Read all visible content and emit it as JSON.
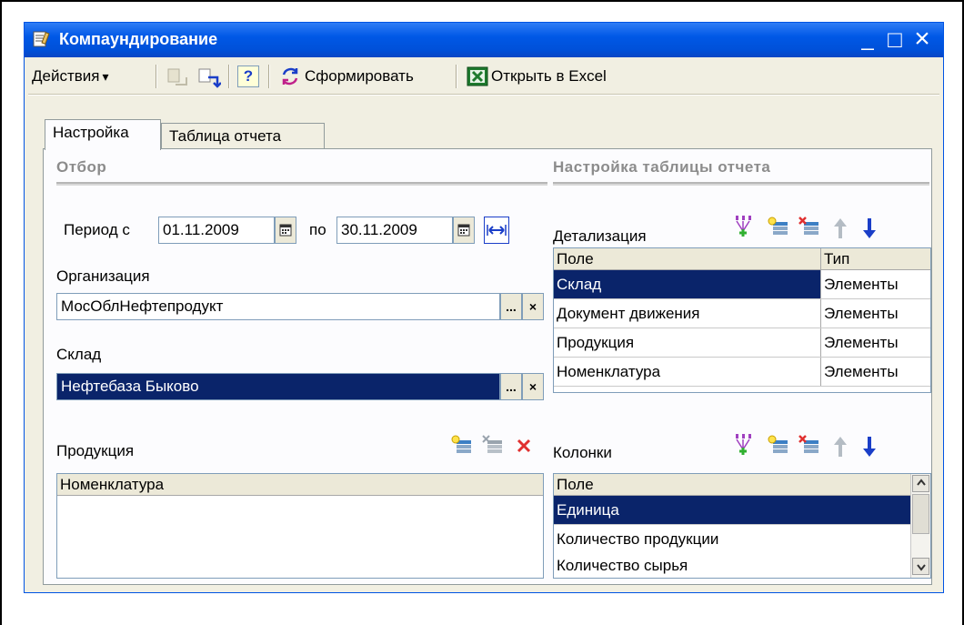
{
  "window": {
    "title": "Компаундирование",
    "minimize": "_",
    "maximize": "□",
    "close": "×"
  },
  "toolbar": {
    "actions_label": "Действия",
    "actions_arrow": "▾",
    "help_label": "?",
    "generate_label": "Сформировать",
    "excel_label": "Открыть в Excel"
  },
  "tabs": [
    {
      "label": "Настройка",
      "active": true
    },
    {
      "label": "Таблица отчета",
      "active": false
    }
  ],
  "filter": {
    "section_title": "Отбор",
    "period_from_label": "Период с",
    "period_from": "01.11.2009",
    "period_to_label": "по",
    "period_to": "30.11.2009",
    "org_label": "Организация",
    "org_value": "МосОблНефтепродукт",
    "warehouse_label": "Склад",
    "warehouse_value": "Нефтебаза Быково",
    "choose_btn": "...",
    "clear_btn": "×",
    "products_label": "Продукция",
    "products_column": "Номенклатура"
  },
  "report_settings": {
    "section_title": "Настройка таблицы отчета",
    "detail_label": "Детализация",
    "detail_columns": [
      "Поле",
      "Тип"
    ],
    "detail_rows": [
      {
        "field": "Склад",
        "type": "Элементы"
      },
      {
        "field": "Документ движения",
        "type": "Элементы"
      },
      {
        "field": "Продукция",
        "type": "Элементы"
      },
      {
        "field": "Номенклатура",
        "type": "Элементы"
      }
    ],
    "columns_label": "Колонки",
    "columns_header": "Поле",
    "columns_rows": [
      "Единица",
      "Количество продукции",
      "Количество сырья"
    ]
  },
  "colors": {
    "title_bar": "#0058e6",
    "selection": "#0a246a",
    "window_bg": "#f1efe2",
    "accent_blue": "#1a3ec8",
    "delete_red": "#e03030"
  }
}
